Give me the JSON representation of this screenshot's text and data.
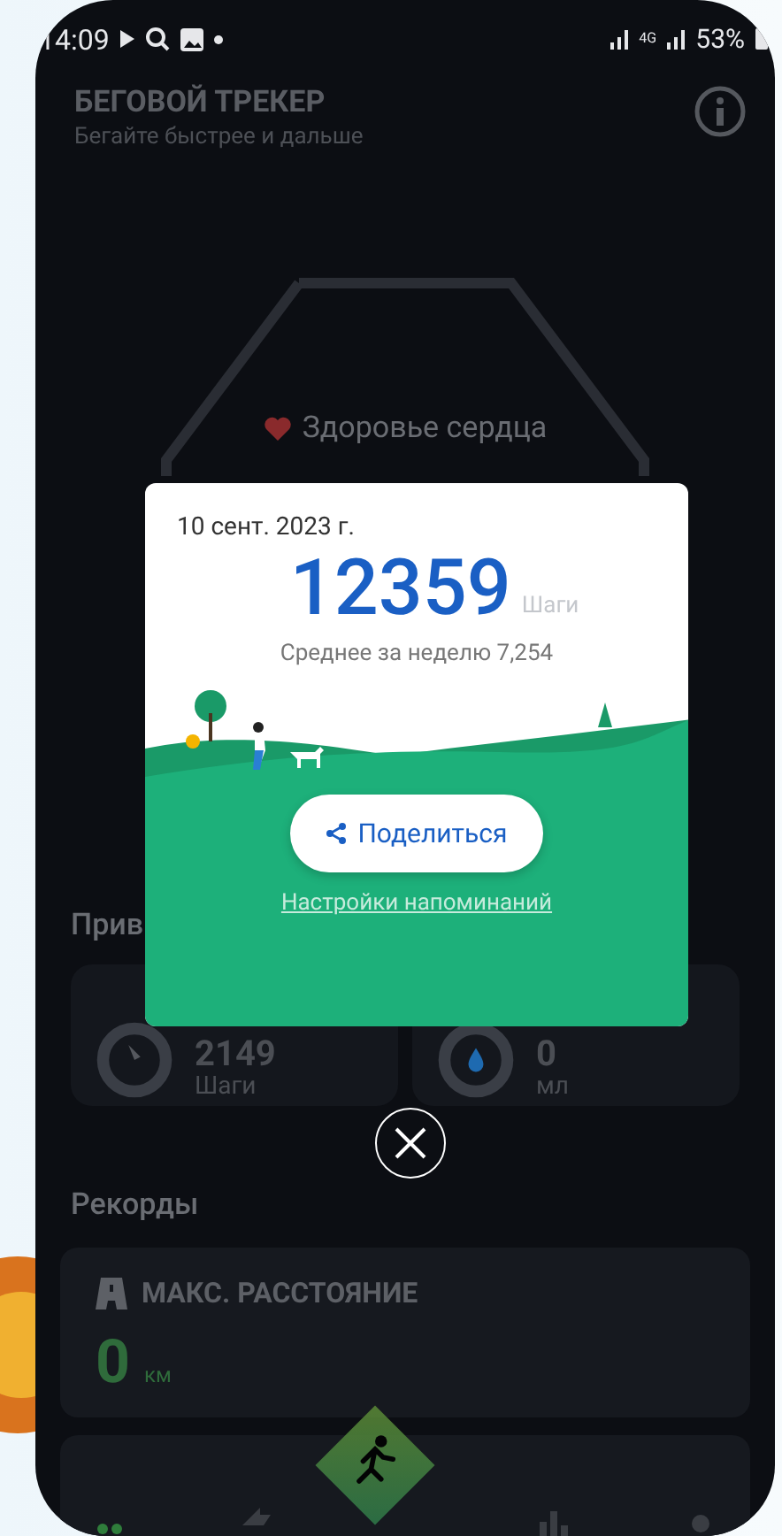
{
  "status_bar": {
    "time": "14:09",
    "network": "4G",
    "battery": "53%"
  },
  "header": {
    "title": "БЕГОВОЙ ТРЕКЕР",
    "subtitle": "Бегайте быстрее и дальше"
  },
  "heart": {
    "label": "Здоровье сердца"
  },
  "habits": {
    "title": "Прив",
    "cards": [
      {
        "kind": "steps",
        "value": "2149",
        "unit": "Шаги"
      },
      {
        "kind": "water",
        "value": "0",
        "unit": "мл"
      }
    ]
  },
  "records": {
    "title": "Рекорды",
    "items": [
      {
        "label": "МАКС. РАССТОЯНИЕ",
        "value": "0",
        "unit": "км"
      }
    ]
  },
  "dialog": {
    "date": "10 сент. 2023 г.",
    "steps": "12359",
    "steps_unit": "Шаги",
    "average": "Среднее за неделю 7,254",
    "share_button": "Поделиться",
    "reminder_link": "Настройки напоминаний"
  },
  "nav": [
    {
      "kind": "home",
      "selected": true
    },
    {
      "kind": "whistle",
      "selected": false
    },
    {
      "kind": "run",
      "selected": false
    },
    {
      "kind": "stats",
      "selected": false
    },
    {
      "kind": "profile",
      "selected": false
    }
  ]
}
